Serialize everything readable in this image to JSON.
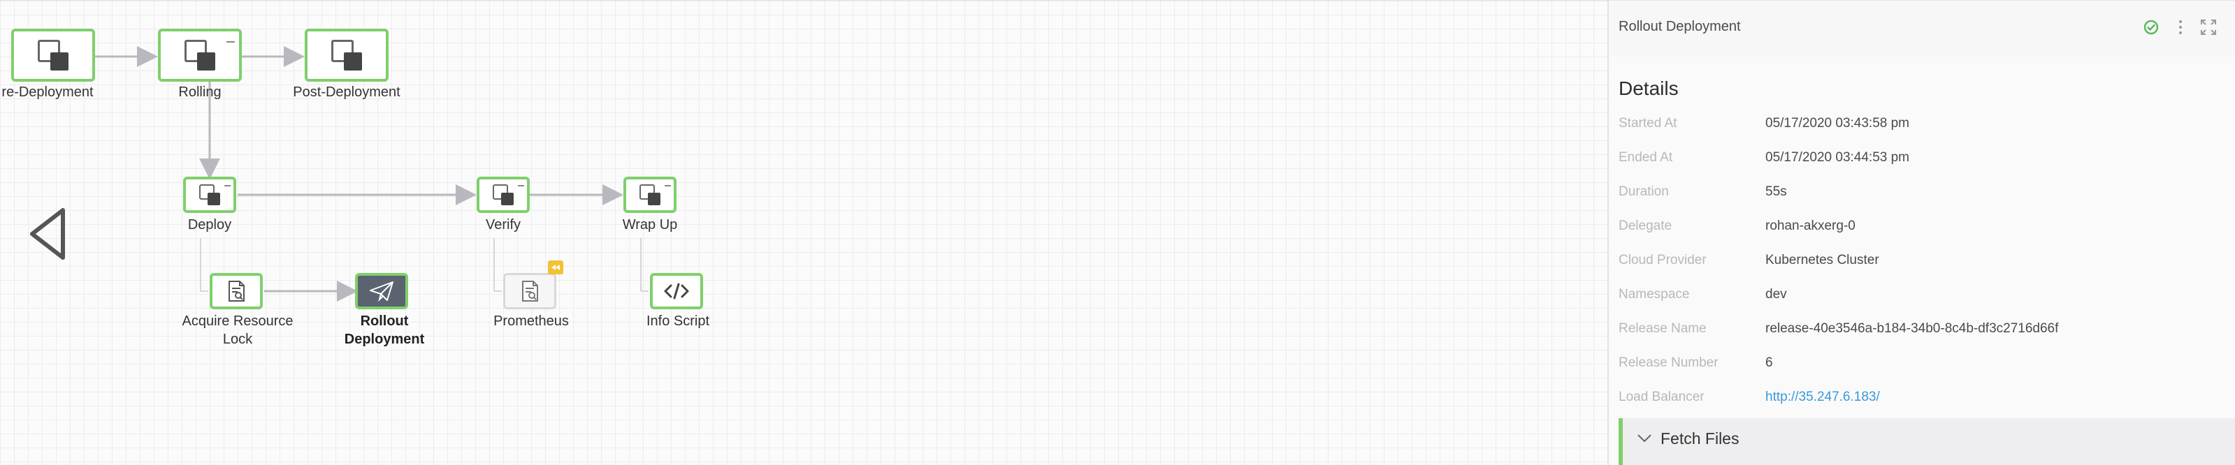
{
  "workflow": {
    "nodes": [
      {
        "id": "pre-deployment",
        "label": "re-Deployment"
      },
      {
        "id": "rolling",
        "label": "Rolling"
      },
      {
        "id": "post-deployment",
        "label": "Post-Deployment"
      },
      {
        "id": "deploy",
        "label": "Deploy"
      },
      {
        "id": "verify",
        "label": "Verify"
      },
      {
        "id": "wrap-up",
        "label": "Wrap Up"
      },
      {
        "id": "acquire-resource-lock",
        "label": "Acquire Resource Lock"
      },
      {
        "id": "rollout-deployment",
        "label": "Rollout Deployment"
      },
      {
        "id": "prometheus",
        "label": "Prometheus"
      },
      {
        "id": "info-script",
        "label": "Info Script"
      }
    ]
  },
  "panel": {
    "title": "Rollout Deployment",
    "details_title": "Details",
    "rows": [
      {
        "key": "Started At",
        "value": "05/17/2020 03:43:58 pm"
      },
      {
        "key": "Ended At",
        "value": "05/17/2020 03:44:53 pm"
      },
      {
        "key": "Duration",
        "value": "55s"
      },
      {
        "key": "Delegate",
        "value": "rohan-akxerg-0"
      },
      {
        "key": "Cloud Provider",
        "value": "Kubernetes Cluster"
      },
      {
        "key": "Namespace",
        "value": "dev"
      },
      {
        "key": "Release Name",
        "value": "release-40e3546a-b184-34b0-8c4b-df3c2716d66f"
      },
      {
        "key": "Release Number",
        "value": "6"
      },
      {
        "key": "Load Balancer",
        "value": "http://35.247.6.183/"
      }
    ],
    "fetch_files": "Fetch Files"
  },
  "colors": {
    "success_green": "#7fcf6c",
    "link_blue": "#3a99d8",
    "selected_node": "#5b6270",
    "skipped_badge": "#f1c232"
  },
  "icons": {
    "status": "check-circle-icon",
    "more": "more-vertical-icon",
    "expand": "expand-icon",
    "back": "triangle-left-icon"
  }
}
